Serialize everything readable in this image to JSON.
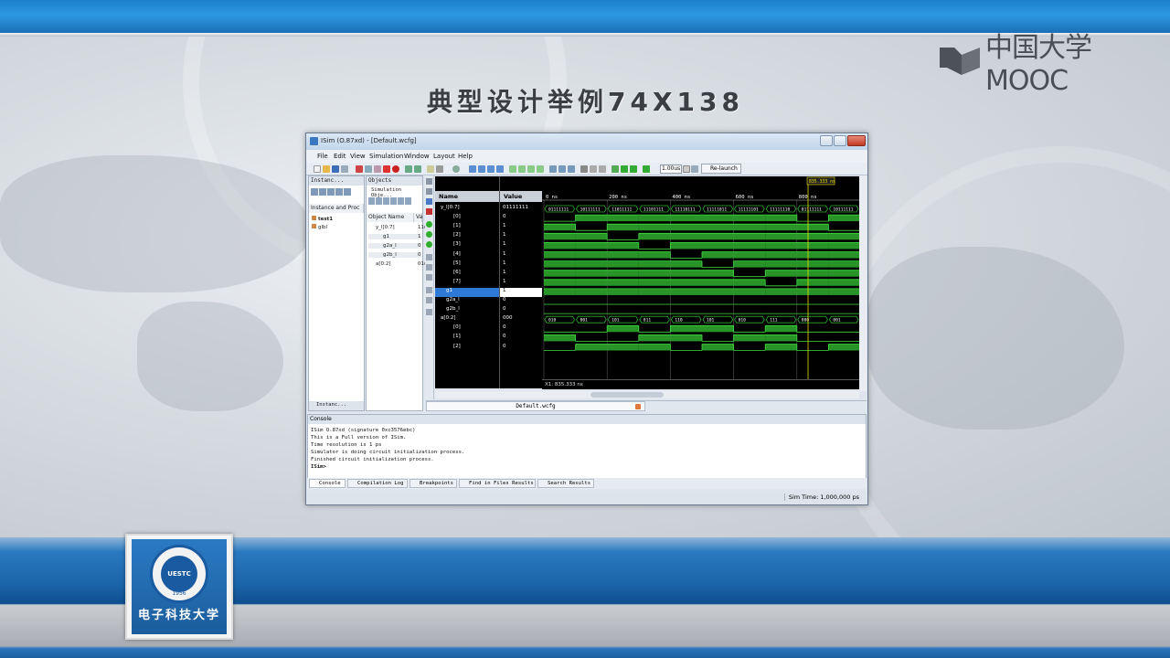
{
  "slide": {
    "title": "典型设计举例74X138",
    "brand": "中国大学MOOC",
    "university": "电子科技大学",
    "seal_text": "UESTC",
    "seal_year": "1956",
    "colors": {
      "top_bar": "#2c98e2",
      "bottom_bar": "#1a63a8",
      "wave_green": "#2fae2f",
      "cursor_yellow": "#e8e000"
    }
  },
  "window": {
    "title": "ISim (O.87xd) - [Default.wcfg]",
    "menu": [
      "File",
      "Edit",
      "View",
      "Simulation",
      "Window",
      "Layout",
      "Help"
    ],
    "toolbar": {
      "time_value": "1.00us",
      "relaunch_label": "Re-launch"
    }
  },
  "instances_pane": {
    "tab": "Instanc...",
    "header": "Instance and Proc",
    "items": [
      "test1",
      "glbl"
    ],
    "bottom_tab": "Instanc..."
  },
  "objects_pane": {
    "tab": "Objects",
    "subtitle": "Simulation Obje...",
    "col_name": "Object Name",
    "col_value": "Va",
    "items": [
      {
        "name": "y_l[0:7]",
        "value": "11("
      },
      {
        "name": "g1",
        "value": "1"
      },
      {
        "name": "g2a_l",
        "value": "0"
      },
      {
        "name": "g2b_l",
        "value": "0"
      },
      {
        "name": "a[0:2]",
        "value": "01("
      }
    ]
  },
  "wave": {
    "col_name": "Name",
    "col_value": "Value",
    "rows": [
      {
        "name": "y_l[0:7]",
        "value": "01111111"
      },
      {
        "name": "[0]",
        "value": "0"
      },
      {
        "name": "[1]",
        "value": "1"
      },
      {
        "name": "[2]",
        "value": "1"
      },
      {
        "name": "[3]",
        "value": "1"
      },
      {
        "name": "[4]",
        "value": "1"
      },
      {
        "name": "[5]",
        "value": "1"
      },
      {
        "name": "[6]",
        "value": "1"
      },
      {
        "name": "[7]",
        "value": "1"
      },
      {
        "name": "g1",
        "value": "1"
      },
      {
        "name": "g2a_l",
        "value": "0"
      },
      {
        "name": "g2b_l",
        "value": "0"
      },
      {
        "name": "a[0:2]",
        "value": "000"
      },
      {
        "name": "[0]",
        "value": "0"
      },
      {
        "name": "[1]",
        "value": "0"
      },
      {
        "name": "[2]",
        "value": "0"
      }
    ],
    "time_ticks": [
      "0 ns",
      "200 ns",
      "400 ns",
      "600 ns",
      "800 ns"
    ],
    "cursor_label": "835.333 ns",
    "cursor_readout": "X1: 835.333 ns",
    "bus_y_values": [
      "01111111",
      "10111111",
      "11011111",
      "11101111",
      "11110111",
      "11111011",
      "11111101",
      "11111110",
      "01111111",
      "10111111"
    ],
    "bus_a_values": [
      "010",
      "001",
      "101",
      "011",
      "110",
      "101",
      "010",
      "111",
      "000",
      "001"
    ],
    "editor_tab": "Default.wcfg"
  },
  "console": {
    "title": "Console",
    "lines": [
      "ISim O.87xd (signature 0xc3576ebc)",
      "This is a Full version of ISim.",
      "Time resolution is 1 ps",
      "Simulator is doing circuit initialization process.",
      "Finished circuit initialization process.",
      "ISim>"
    ],
    "tabs": [
      "Console",
      "Compilation Log",
      "Breakpoints",
      "Find in Files Results",
      "Search Results"
    ],
    "sim_time": "Sim Time: 1,000,000 ps"
  }
}
